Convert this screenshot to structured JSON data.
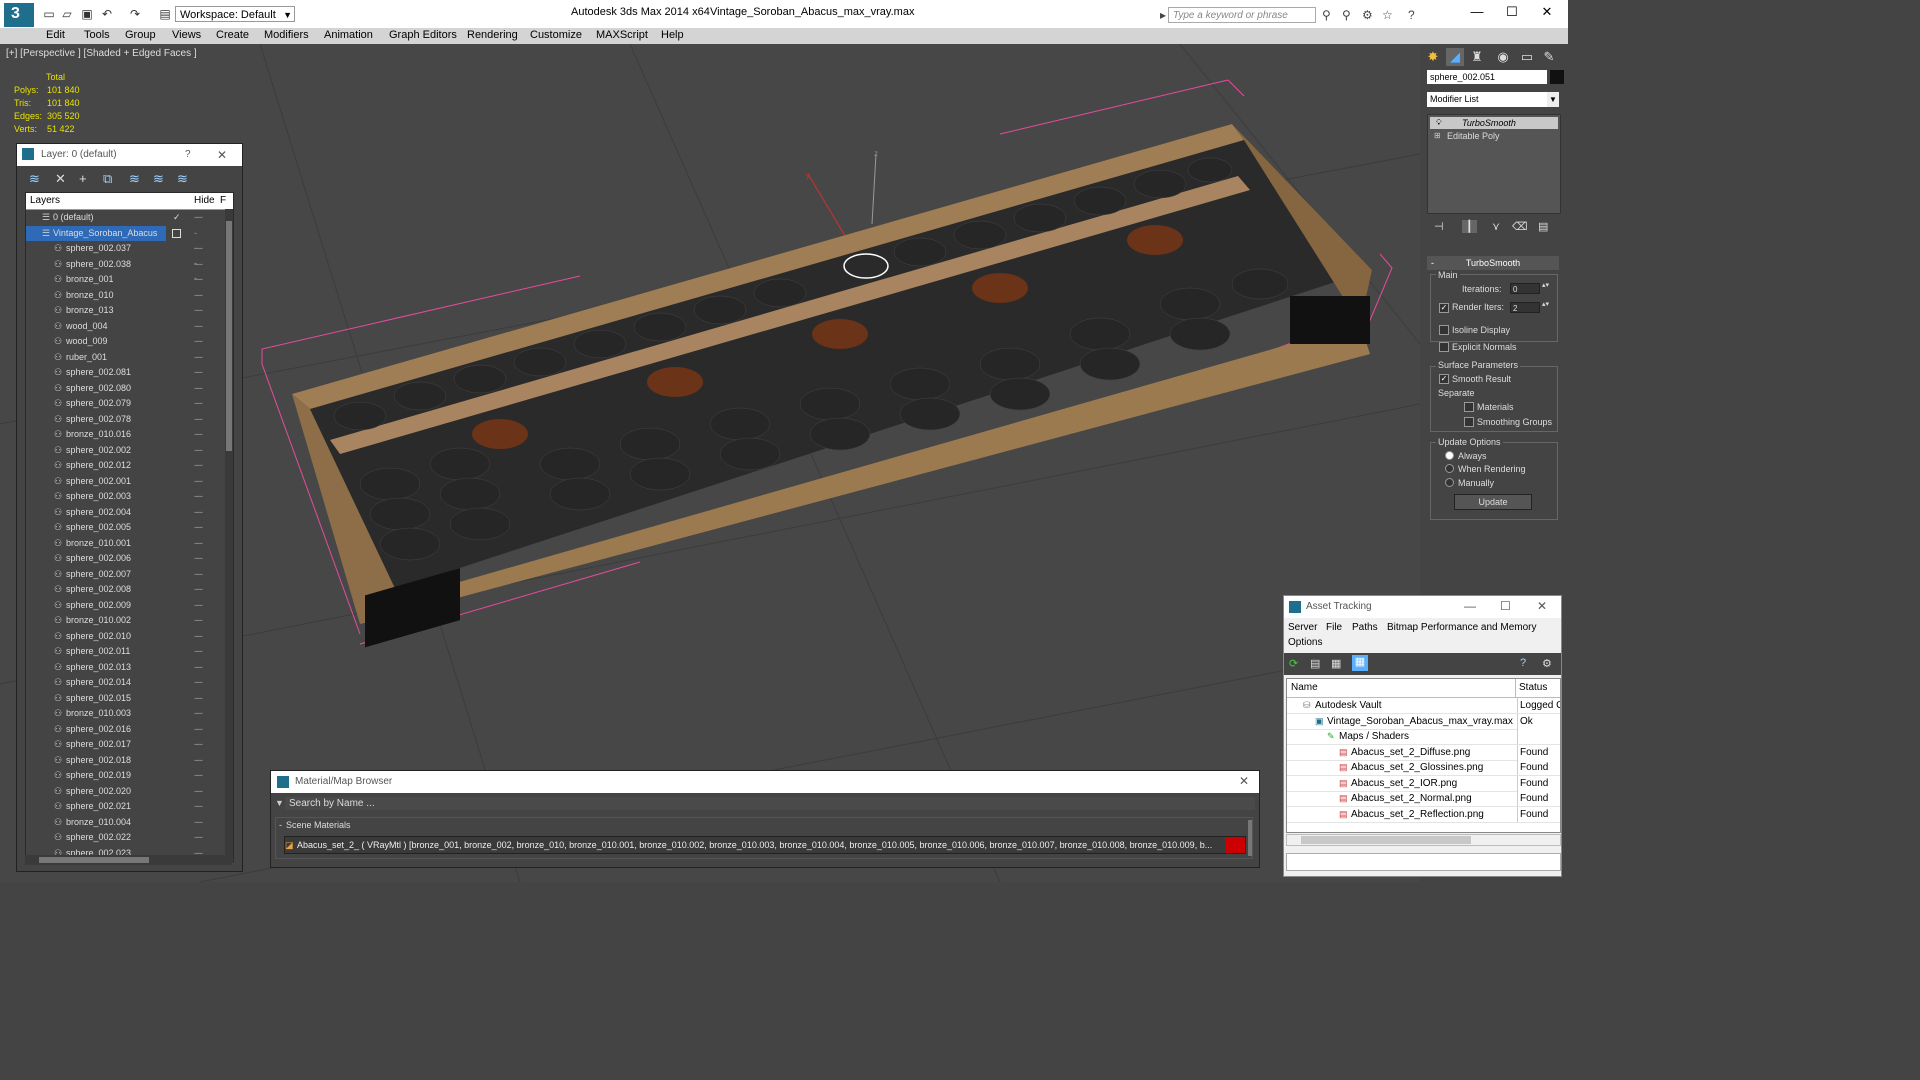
{
  "titlebar": {
    "workspace": "Workspace: Default",
    "app_title": "Autodesk 3ds Max  2014 x64",
    "file_title": "Vintage_Soroban_Abacus_max_vray.max",
    "search_placeholder": "Type a keyword or phrase"
  },
  "menu": [
    "Edit",
    "Tools",
    "Group",
    "Views",
    "Create",
    "Modifiers",
    "Animation",
    "Graph Editors",
    "Rendering",
    "Customize",
    "MAXScript",
    "Help"
  ],
  "viewport": {
    "label": "[+] [Perspective ] [Shaded + Edged Faces ]",
    "stats": {
      "header": "Total",
      "rows": [
        {
          "label": "Polys:",
          "value": "101 840"
        },
        {
          "label": "Tris:",
          "value": "101 840"
        },
        {
          "label": "Edges:",
          "value": "305 520"
        },
        {
          "label": "Verts:",
          "value": "51 422"
        }
      ]
    }
  },
  "layer_panel": {
    "title": "Layer: 0 (default)",
    "help": "?",
    "close": "✕",
    "col_layers": "Layers",
    "col_hide": "Hide",
    "col_f": "F",
    "layers": [
      {
        "name": "0 (default)",
        "level": 0,
        "selected": false
      },
      {
        "name": "Vintage_Soroban_Abacus",
        "level": 0,
        "selected": true
      },
      {
        "name": "sphere_002.037",
        "level": 1
      },
      {
        "name": "sphere_002.038",
        "level": 1
      },
      {
        "name": "bronze_001",
        "level": 1
      },
      {
        "name": "bronze_010",
        "level": 1
      },
      {
        "name": "bronze_013",
        "level": 1
      },
      {
        "name": "wood_004",
        "level": 1
      },
      {
        "name": "wood_009",
        "level": 1
      },
      {
        "name": "ruber_001",
        "level": 1
      },
      {
        "name": "sphere_002.081",
        "level": 1
      },
      {
        "name": "sphere_002.080",
        "level": 1
      },
      {
        "name": "sphere_002.079",
        "level": 1
      },
      {
        "name": "sphere_002.078",
        "level": 1
      },
      {
        "name": "bronze_010.016",
        "level": 1
      },
      {
        "name": "sphere_002.002",
        "level": 1
      },
      {
        "name": "sphere_002.012",
        "level": 1
      },
      {
        "name": "sphere_002.001",
        "level": 1
      },
      {
        "name": "sphere_002.003",
        "level": 1
      },
      {
        "name": "sphere_002.004",
        "level": 1
      },
      {
        "name": "sphere_002.005",
        "level": 1
      },
      {
        "name": "bronze_010.001",
        "level": 1
      },
      {
        "name": "sphere_002.006",
        "level": 1
      },
      {
        "name": "sphere_002.007",
        "level": 1
      },
      {
        "name": "sphere_002.008",
        "level": 1
      },
      {
        "name": "sphere_002.009",
        "level": 1
      },
      {
        "name": "bronze_010.002",
        "level": 1
      },
      {
        "name": "sphere_002.010",
        "level": 1
      },
      {
        "name": "sphere_002.011",
        "level": 1
      },
      {
        "name": "sphere_002.013",
        "level": 1
      },
      {
        "name": "sphere_002.014",
        "level": 1
      },
      {
        "name": "sphere_002.015",
        "level": 1
      },
      {
        "name": "bronze_010.003",
        "level": 1
      },
      {
        "name": "sphere_002.016",
        "level": 1
      },
      {
        "name": "sphere_002.017",
        "level": 1
      },
      {
        "name": "sphere_002.018",
        "level": 1
      },
      {
        "name": "sphere_002.019",
        "level": 1
      },
      {
        "name": "sphere_002.020",
        "level": 1
      },
      {
        "name": "sphere_002.021",
        "level": 1
      },
      {
        "name": "bronze_010.004",
        "level": 1
      },
      {
        "name": "sphere_002.022",
        "level": 1
      },
      {
        "name": "sphere_002.023",
        "level": 1
      }
    ]
  },
  "command_panel": {
    "object_name": "sphere_002.051",
    "modifier_list": "Modifier List",
    "stack": [
      "TurboSmooth",
      "Editable Poly"
    ],
    "rollout_title": "TurboSmooth",
    "main_group": "Main",
    "iterations_label": "Iterations:",
    "iterations_value": "0",
    "render_iters_label": "Render Iters:",
    "render_iters_value": "2",
    "isoline_display": "Isoline Display",
    "explicit_normals": "Explicit Normals",
    "surface_params": "Surface Parameters",
    "smooth_result": "Smooth Result",
    "separate": "Separate",
    "materials": "Materials",
    "smoothing_groups": "Smoothing Groups",
    "update_options": "Update Options",
    "always": "Always",
    "when_rendering": "When Rendering",
    "manually": "Manually",
    "update_button": "Update"
  },
  "material_browser": {
    "title": "Material/Map Browser",
    "search_placeholder": "Search by Name ...",
    "section": "Scene Materials",
    "row_text": "Abacus_set_2_  ( VRayMtl )  [bronze_001, bronze_002, bronze_010, bronze_010.001, bronze_010.002, bronze_010.003, bronze_010.004, bronze_010.005, bronze_010.006, bronze_010.007, bronze_010.008, bronze_010.009, b..."
  },
  "asset_tracking": {
    "title": "Asset Tracking",
    "menu": [
      "Server",
      "File",
      "Paths",
      "Bitmap Performance and Memory",
      "Options"
    ],
    "col_name": "Name",
    "col_status": "Status",
    "rows": [
      {
        "name": "Autodesk Vault",
        "status": "Logged C",
        "indent": 1,
        "icon": "vault"
      },
      {
        "name": "Vintage_Soroban_Abacus_max_vray.max",
        "status": "Ok",
        "indent": 2,
        "icon": "max"
      },
      {
        "name": "Maps / Shaders",
        "status": "",
        "indent": 3,
        "icon": "maps"
      },
      {
        "name": "Abacus_set_2_Diffuse.png",
        "status": "Found",
        "indent": 4,
        "icon": "png"
      },
      {
        "name": "Abacus_set_2_Glossines.png",
        "status": "Found",
        "indent": 4,
        "icon": "png"
      },
      {
        "name": "Abacus_set_2_IOR.png",
        "status": "Found",
        "indent": 4,
        "icon": "png"
      },
      {
        "name": "Abacus_set_2_Normal.png",
        "status": "Found",
        "indent": 4,
        "icon": "png"
      },
      {
        "name": "Abacus_set_2_Reflection.png",
        "status": "Found",
        "indent": 4,
        "icon": "png"
      }
    ]
  }
}
